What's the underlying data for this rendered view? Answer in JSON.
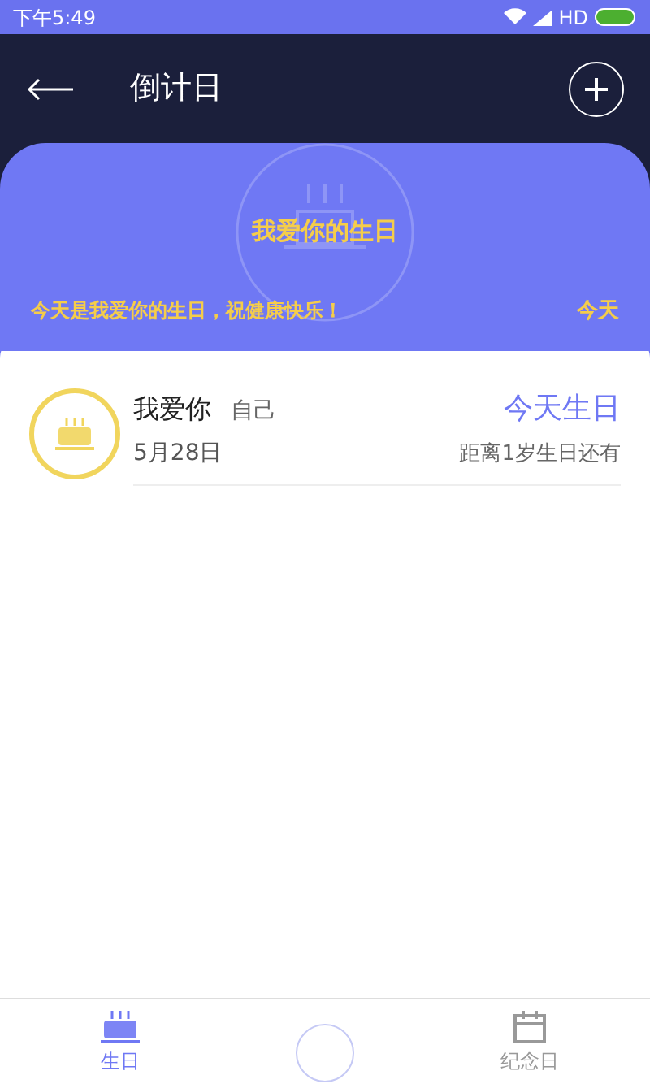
{
  "status_bar": {
    "time": "下午5:49",
    "network": "HD"
  },
  "header": {
    "title": "倒计日"
  },
  "banner": {
    "title": "我爱你的生日",
    "message": "今天是我爱你的生日，祝健康快乐！",
    "day": "今天"
  },
  "events": [
    {
      "name": "我爱你",
      "relation": "自己",
      "date": "5月28日",
      "status": "今天生日",
      "note": "距离1岁生日还有"
    }
  ],
  "tabs": [
    {
      "kind": "cake",
      "label": "生日",
      "selected": true
    },
    {
      "kind": "add"
    },
    {
      "kind": "calendar",
      "label": "纪念日",
      "selected": false
    }
  ]
}
